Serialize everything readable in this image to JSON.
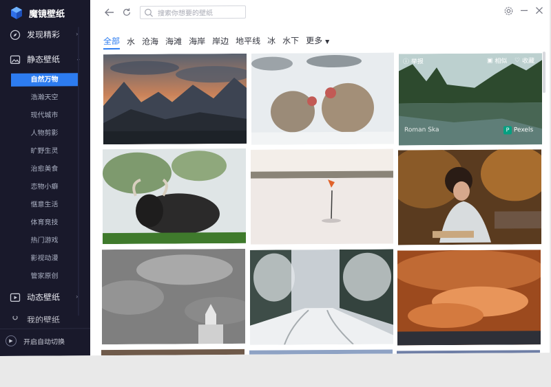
{
  "app": {
    "title": "魔镜壁纸"
  },
  "sidebar": {
    "discover": {
      "label": "发现精彩",
      "icon": "compass-icon"
    },
    "static": {
      "label": "静态壁纸",
      "icon": "image-icon"
    },
    "sub_items": [
      {
        "label": "自然万物"
      },
      {
        "label": "浩瀚天空"
      },
      {
        "label": "现代城市"
      },
      {
        "label": "人物剪影"
      },
      {
        "label": "旷野生灵"
      },
      {
        "label": "治愈美食"
      },
      {
        "label": "恋物小癖"
      },
      {
        "label": "惬意生活"
      },
      {
        "label": "体育竞技"
      },
      {
        "label": "热门游戏"
      },
      {
        "label": "影视动漫"
      },
      {
        "label": "管家原创"
      }
    ],
    "dynamic": {
      "label": "动态壁纸",
      "icon": "video-icon"
    },
    "hidden_item": {
      "label": "我的壁纸"
    },
    "auto_switch": {
      "label": "开启自动切换"
    }
  },
  "topbar": {
    "search_placeholder": "搜索你想要的壁纸"
  },
  "categories": [
    {
      "label": "全部"
    },
    {
      "label": "水"
    },
    {
      "label": "沧海"
    },
    {
      "label": "海滩"
    },
    {
      "label": "海岸"
    },
    {
      "label": "岸边"
    },
    {
      "label": "地平线"
    },
    {
      "label": "冰"
    },
    {
      "label": "水下"
    },
    {
      "label": "更多"
    }
  ],
  "overlay": {
    "report": "举报",
    "similar": "相似",
    "favorite": "收藏",
    "author": "Roman Ska",
    "source": "Pexels"
  },
  "colors": {
    "sidebar_bg": "#19192b",
    "accent": "#2d7cf0"
  }
}
